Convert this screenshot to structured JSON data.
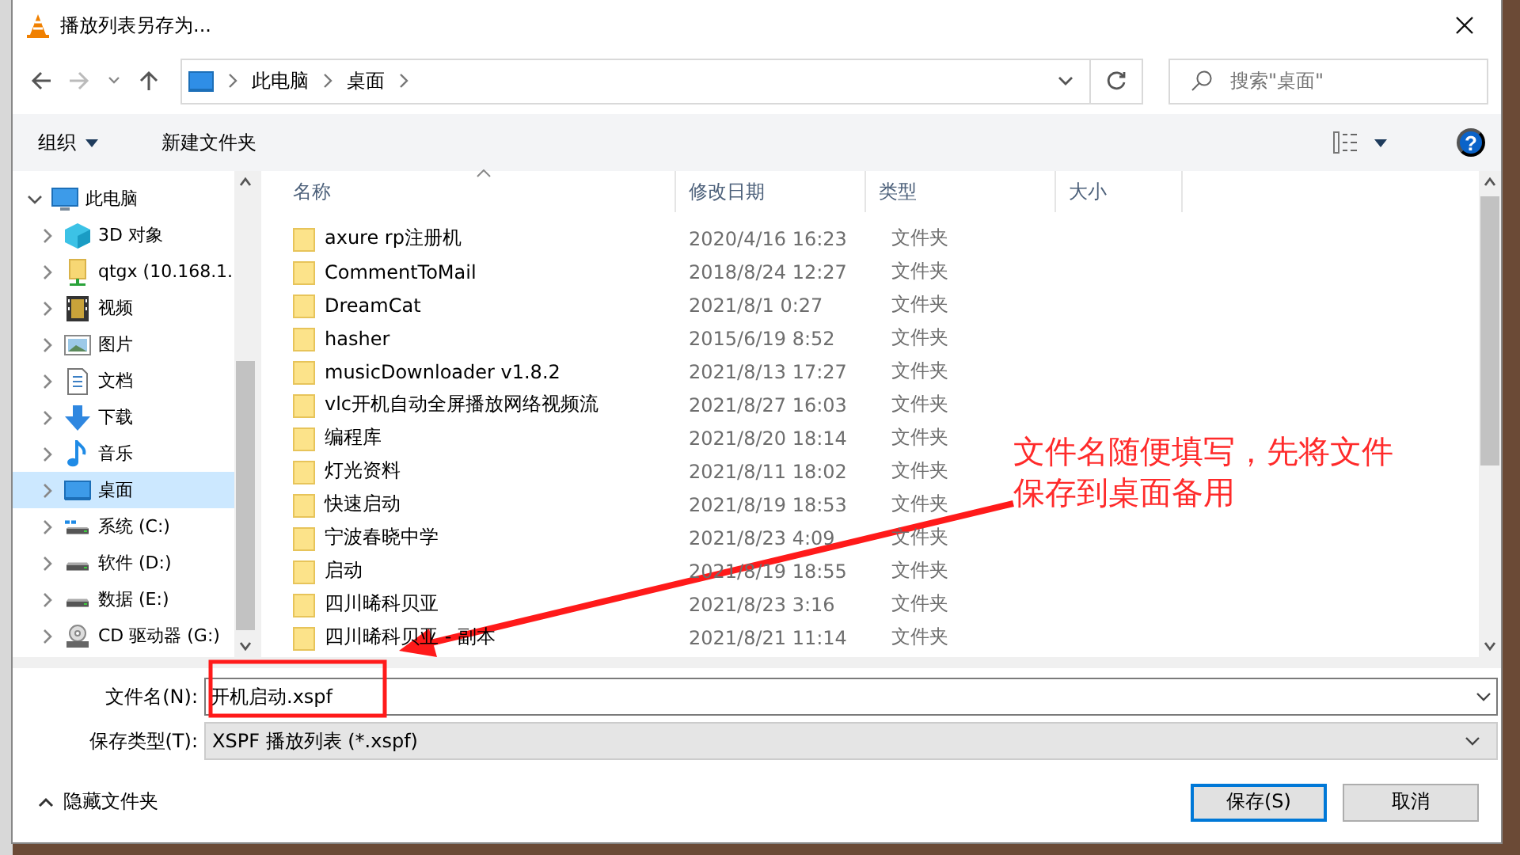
{
  "window": {
    "title": "播放列表另存为..."
  },
  "address_bar": {
    "crumbs": [
      "此电脑",
      "桌面"
    ]
  },
  "search": {
    "placeholder": "搜索\"桌面\""
  },
  "toolbar": {
    "organize": "组织",
    "new_folder": "新建文件夹",
    "help": "?"
  },
  "nav_pane": {
    "items": [
      {
        "label": "此电脑",
        "kind": "computer",
        "expanded": true,
        "selected": false,
        "children": [
          {
            "label": "3D 对象",
            "kind": "cube",
            "expanded": false,
            "selected": false
          },
          {
            "label": "qtgx (10.168.1.",
            "kind": "network",
            "expanded": false,
            "selected": false
          },
          {
            "label": "视频",
            "kind": "video",
            "expanded": false,
            "selected": false
          },
          {
            "label": "图片",
            "kind": "picture",
            "expanded": false,
            "selected": false
          },
          {
            "label": "文档",
            "kind": "document",
            "expanded": false,
            "selected": false
          },
          {
            "label": "下载",
            "kind": "download",
            "expanded": false,
            "selected": false
          },
          {
            "label": "音乐",
            "kind": "music",
            "expanded": false,
            "selected": false
          },
          {
            "label": "桌面",
            "kind": "desktop",
            "expanded": false,
            "selected": true
          },
          {
            "label": "系统 (C:)",
            "kind": "system-drive",
            "expanded": false,
            "selected": false
          },
          {
            "label": "软件 (D:)",
            "kind": "drive",
            "expanded": false,
            "selected": false
          },
          {
            "label": "数据 (E:)",
            "kind": "drive",
            "expanded": false,
            "selected": false
          },
          {
            "label": "CD 驱动器 (G:)",
            "kind": "cd",
            "expanded": false,
            "selected": false
          }
        ]
      }
    ]
  },
  "table": {
    "columns": [
      "名称",
      "修改日期",
      "类型",
      "大小"
    ],
    "rows": [
      {
        "name": "axure rp注册机",
        "date": "2020/4/16 16:23",
        "type": "文件夹",
        "selected": false
      },
      {
        "name": "CommentToMail",
        "date": "2018/8/24 12:27",
        "type": "文件夹",
        "selected": false
      },
      {
        "name": "DreamCat",
        "date": "2021/8/1 0:27",
        "type": "文件夹",
        "selected": false
      },
      {
        "name": "hasher",
        "date": "2015/6/19 8:52",
        "type": "文件夹",
        "selected": false
      },
      {
        "name": "musicDownloader v1.8.2",
        "date": "2021/8/13 17:27",
        "type": "文件夹",
        "selected": false
      },
      {
        "name": "vlc开机自动全屏播放网络视频流",
        "date": "2021/8/27 16:03",
        "type": "文件夹",
        "selected": false
      },
      {
        "name": "编程库",
        "date": "2021/8/20 18:14",
        "type": "文件夹",
        "selected": false
      },
      {
        "name": "灯光资料",
        "date": "2021/8/11 18:02",
        "type": "文件夹",
        "selected": false
      },
      {
        "name": "快速启动",
        "date": "2021/8/19 18:53",
        "type": "文件夹",
        "selected": false
      },
      {
        "name": "宁波春晓中学",
        "date": "2021/8/23 4:09",
        "type": "文件夹",
        "selected": false
      },
      {
        "name": "启动",
        "date": "2021/8/19 18:55",
        "type": "文件夹",
        "selected": false
      },
      {
        "name": "四川晞科贝亚",
        "date": "2021/8/23 3:16",
        "type": "文件夹",
        "selected": false
      },
      {
        "name": "四川晞科贝亚 - 副本",
        "date": "2021/8/21 11:14",
        "type": "文件夹",
        "selected": false
      }
    ]
  },
  "form": {
    "filename_label": "文件名(N):",
    "filename": "开机启动.xspf",
    "type_label": "保存类型(T):",
    "type": "XSPF 播放列表 (*.xspf)"
  },
  "footer": {
    "hide_folders": "隐藏文件夹",
    "buttons": [
      {
        "label": "保存(S)",
        "default": true
      },
      {
        "label": "取消",
        "default": false
      }
    ]
  },
  "annotation": {
    "text": "文件名随便填写，先将文件保存到桌面备用"
  }
}
